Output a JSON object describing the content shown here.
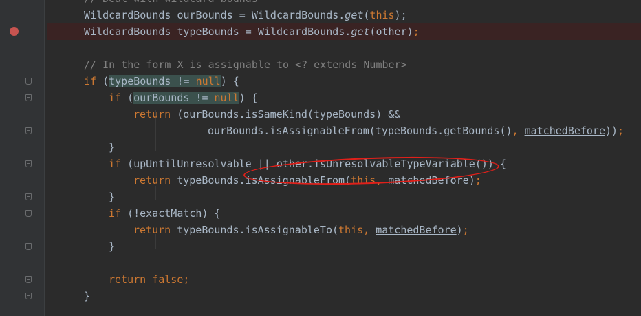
{
  "lines": [
    {
      "id": "l1",
      "tokens": [
        {
          "t": "// Deal with wildcard bounds",
          "c": "cm"
        }
      ]
    },
    {
      "id": "l2",
      "tokens": [
        {
          "t": "WildcardBounds ourBounds = WildcardBounds."
        },
        {
          "t": "get",
          "c": "it"
        },
        {
          "t": "("
        },
        {
          "t": "this",
          "c": "kw"
        },
        {
          "t": ");"
        }
      ]
    },
    {
      "id": "l3",
      "tokens": [
        {
          "t": "WildcardBounds typeBounds = WildcardBounds."
        },
        {
          "t": "get",
          "c": "it"
        },
        {
          "t": "(other)"
        },
        {
          "t": ";",
          "c": "kw"
        }
      ]
    },
    {
      "id": "l4",
      "tokens": []
    },
    {
      "id": "l5",
      "tokens": [
        {
          "t": "// In the form X is assignable to <? extends Number>",
          "c": "cm"
        }
      ]
    },
    {
      "id": "l6",
      "tokens": [
        {
          "t": "if ",
          "c": "kw"
        },
        {
          "t": "("
        },
        {
          "t": "typeBounds != ",
          "c": "hl"
        },
        {
          "t": "null",
          "c": "kw hl"
        },
        {
          "t": ") {"
        }
      ]
    },
    {
      "id": "l7",
      "tokens": [
        {
          "t": "if ",
          "c": "kw"
        },
        {
          "t": "("
        },
        {
          "t": "ourBounds != ",
          "c": "hl"
        },
        {
          "t": "null",
          "c": "kw hl"
        },
        {
          "t": ") {"
        }
      ]
    },
    {
      "id": "l8",
      "tokens": [
        {
          "t": "return ",
          "c": "kw"
        },
        {
          "t": "(ourBounds.isSameKind(typeBounds) &&"
        }
      ]
    },
    {
      "id": "l9",
      "tokens": [
        {
          "t": "ourBounds.isAssignableFrom(typeBounds.getBounds()"
        },
        {
          "t": ", ",
          "c": "kw"
        },
        {
          "t": "matchedBefore",
          "c": "fld"
        },
        {
          "t": "))"
        },
        {
          "t": ";",
          "c": "kw"
        }
      ]
    },
    {
      "id": "l10",
      "tokens": [
        {
          "t": "}"
        }
      ]
    },
    {
      "id": "l11",
      "tokens": [
        {
          "t": "if ",
          "c": "kw"
        },
        {
          "t": "(upUntilUnresolvable || other.isUnresolvableTypeVariable()) {"
        }
      ]
    },
    {
      "id": "l12",
      "tokens": [
        {
          "t": "return ",
          "c": "kw"
        },
        {
          "t": "typeBounds.isAssignableFrom("
        },
        {
          "t": "this",
          "c": "kw"
        },
        {
          "t": ", ",
          "c": "kw"
        },
        {
          "t": "matchedBefore",
          "c": "fld"
        },
        {
          "t": ")"
        },
        {
          "t": ";",
          "c": "kw"
        }
      ]
    },
    {
      "id": "l13",
      "tokens": [
        {
          "t": "}"
        }
      ]
    },
    {
      "id": "l14",
      "tokens": [
        {
          "t": "if ",
          "c": "kw"
        },
        {
          "t": "(!"
        },
        {
          "t": "exactMatch",
          "c": "fld"
        },
        {
          "t": ") {"
        }
      ]
    },
    {
      "id": "l15",
      "tokens": [
        {
          "t": "return ",
          "c": "kw"
        },
        {
          "t": "typeBounds.isAssignableTo("
        },
        {
          "t": "this",
          "c": "kw"
        },
        {
          "t": ", ",
          "c": "kw"
        },
        {
          "t": "matchedBefore",
          "c": "fld"
        },
        {
          "t": ")"
        },
        {
          "t": ";",
          "c": "kw"
        }
      ]
    },
    {
      "id": "l16",
      "tokens": [
        {
          "t": "}"
        }
      ]
    },
    {
      "id": "l17",
      "tokens": []
    },
    {
      "id": "l18",
      "tokens": [
        {
          "t": "return false",
          "c": "kw"
        },
        {
          "t": ";",
          "c": "kw"
        }
      ]
    },
    {
      "id": "l19",
      "tokens": [
        {
          "t": "}"
        }
      ]
    }
  ],
  "colors": {
    "background": "#2b2b2b",
    "keyword": "#cc7832",
    "comment": "#808080",
    "text": "#a9b7c6",
    "breakpoint": "#c75450",
    "annotation": "#e0201a"
  }
}
